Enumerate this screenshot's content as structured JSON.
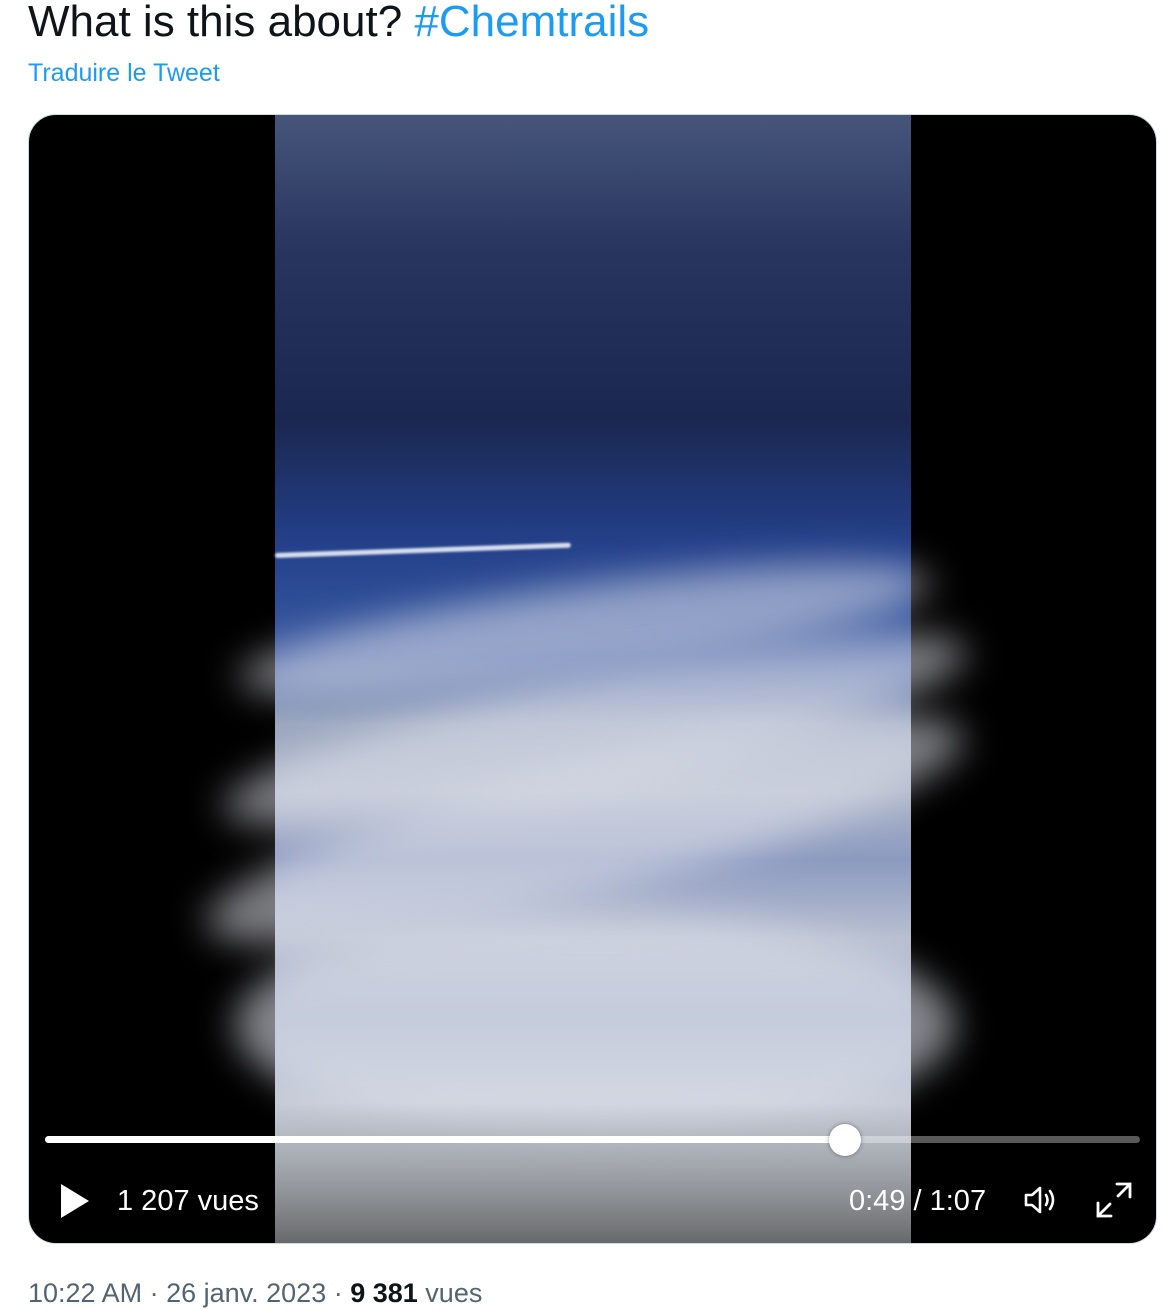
{
  "tweet": {
    "text": "What is this about? ",
    "hashtag": "#Chemtrails",
    "translate_label": "Traduire le Tweet"
  },
  "video": {
    "views_label": "1 207 vues",
    "current_time": "0:49",
    "separator": " / ",
    "duration": "1:07",
    "progress_fraction": 0.731,
    "icons": {
      "play": "play-icon",
      "volume": "volume-icon",
      "fullscreen": "fullscreen-icon"
    }
  },
  "meta": {
    "time": "10:22 AM",
    "separator": " · ",
    "date": "26 janv. 2023",
    "views_count": "9 381",
    "views_unit": " vues"
  },
  "colors": {
    "accent": "#1d9bf0",
    "text": "#0f1419",
    "secondary": "#536471"
  }
}
